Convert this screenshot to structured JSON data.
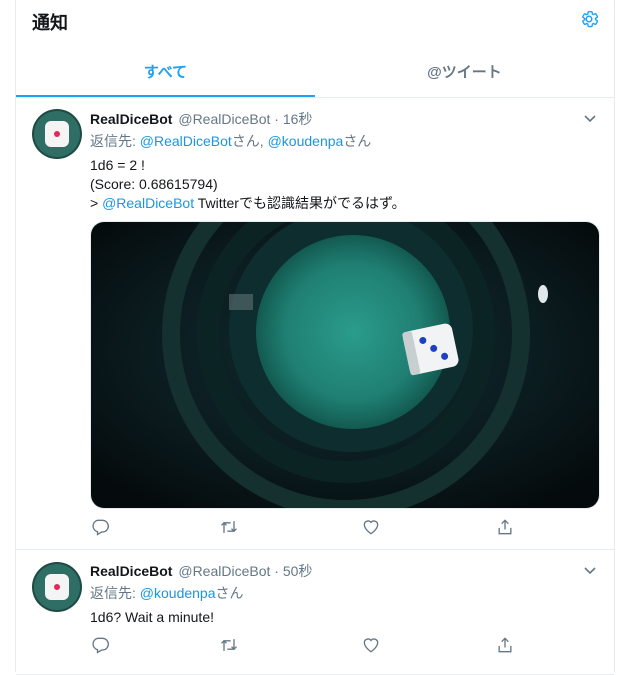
{
  "header": {
    "title": "通知",
    "settings_icon": "gear-icon"
  },
  "tabs": [
    {
      "label": "すべて",
      "active": true
    },
    {
      "label": "@ツイート",
      "active": false
    }
  ],
  "colors": {
    "accent": "#1da1f2",
    "link": "#1b95e0",
    "muted": "#657786",
    "dice_pip": "#1d3fc4"
  },
  "tweets": [
    {
      "name": "RealDiceBot",
      "handle": "@RealDiceBot",
      "sep": "·",
      "time": "16秒",
      "reply_prefix": "返信先: ",
      "reply_to_1": "@RealDiceBot",
      "reply_mid": "さん, ",
      "reply_to_2": "@koudenpa",
      "reply_suffix": "さん",
      "line1": "1d6 = 2 !",
      "line2": "(Score: 0.68615794)",
      "line3_prefix": "> ",
      "line3_mention": "@RealDiceBot",
      "line3_rest": " Twitterでも認識結果がでるはず。",
      "media": "dice-in-cup-photo"
    },
    {
      "name": "RealDiceBot",
      "handle": "@RealDiceBot",
      "sep": "·",
      "time": "50秒",
      "reply_prefix": "返信先: ",
      "reply_to": "@koudenpa",
      "reply_suffix": "さん",
      "text": "1d6? Wait a minute!"
    }
  ],
  "action_icons": [
    "reply-icon",
    "retweet-icon",
    "like-icon",
    "share-icon"
  ]
}
